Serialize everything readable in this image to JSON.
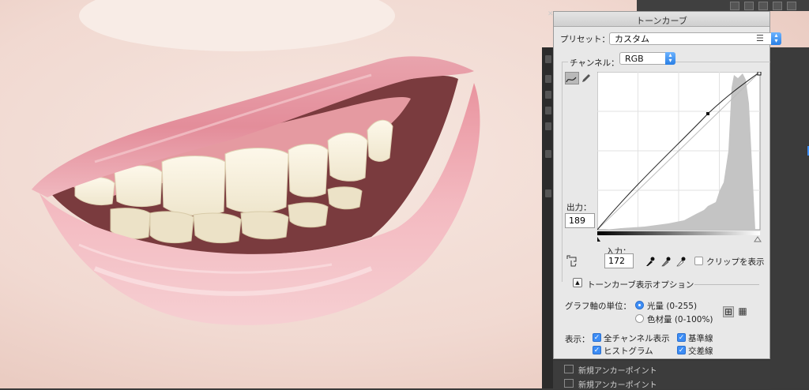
{
  "window_title": "トーンカーブ",
  "preset": {
    "label": "プリセット：",
    "value": "カスタム"
  },
  "channel": {
    "label": "チャンネル：",
    "value": "RGB"
  },
  "output": {
    "label": "出力：",
    "value": "189"
  },
  "input": {
    "label": "入力：",
    "value": "172"
  },
  "clip_label": "クリップを表示",
  "options_title": "トーンカーブ表示オプション",
  "graph_unit": {
    "label": "グラフ軸の単位：",
    "options": [
      "光量 (0-255)",
      "色材量 (0-100%)"
    ],
    "selected": "光量 (0-255)"
  },
  "display": {
    "label": "表示：",
    "checks": [
      {
        "label": "全チャンネル表示",
        "checked": true
      },
      {
        "label": "基準線",
        "checked": true
      },
      {
        "label": "ヒストグラム",
        "checked": true
      },
      {
        "label": "交差線",
        "checked": true
      }
    ]
  },
  "layers": [
    "新規アンカーポイント",
    "新規アンカーポイント"
  ],
  "colors": {
    "accent": "#3d8df5",
    "panel_bg": "#e8e8e8"
  },
  "icons": [
    "close-icon",
    "menu-icon",
    "curve-tool-icon",
    "pencil-tool-icon",
    "target-adjust-icon",
    "black-eyedropper-icon",
    "gray-eyedropper-icon",
    "white-eyedropper-icon",
    "grid-4-icon",
    "grid-10-icon",
    "collapse-triangle-icon",
    "layer-icon"
  ]
}
